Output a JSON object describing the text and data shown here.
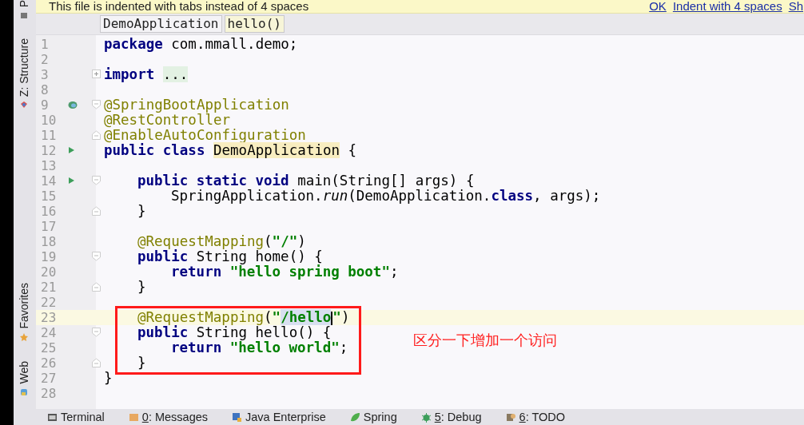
{
  "banner": {
    "message": "This file is indented with tabs instead of 4 spaces",
    "links": [
      "OK",
      "Indent with 4 spaces",
      "Sh"
    ]
  },
  "tool_stripe": [
    {
      "label": "P"
    },
    {
      "label": "Z: Structure"
    },
    {
      "label": "Favorites"
    },
    {
      "label": "Web"
    }
  ],
  "breadcrumbs": [
    {
      "label": "DemoApplication",
      "selected": false
    },
    {
      "label": "hello()",
      "selected": true
    }
  ],
  "lines": [
    {
      "number": "1",
      "kind": "top",
      "tokens": [
        {
          "kind": "keyword",
          "text": "package"
        },
        {
          "kind": "plain",
          "text": " com.mmall.demo;"
        }
      ]
    },
    {
      "number": "2",
      "kind": "blank"
    },
    {
      "number": "3",
      "kind": "top",
      "collapsed": true,
      "tokens": [
        {
          "kind": "keyword",
          "text": "import"
        },
        {
          "kind": "folded",
          "text": "..."
        }
      ]
    },
    {
      "number": "8",
      "kind": "blank"
    },
    {
      "number": "9",
      "kind": "top",
      "bean_marker": true,
      "fold_start": true,
      "tokens": [
        {
          "kind": "annotation",
          "text": "@SpringBootApplication"
        }
      ]
    },
    {
      "number": "10",
      "kind": "top",
      "tokens": [
        {
          "kind": "annotation",
          "text": "@RestController"
        }
      ]
    },
    {
      "number": "11",
      "kind": "top",
      "fold_end": true,
      "tokens": [
        {
          "kind": "annotation",
          "text": "@EnableAutoConfiguration"
        }
      ]
    },
    {
      "number": "12",
      "kind": "top",
      "run_marker": true,
      "tokens": [
        {
          "kind": "keyword",
          "text": "public class"
        },
        {
          "kind": "match",
          "text": "DemoApplication"
        },
        {
          "kind": "plain",
          "text": "{"
        }
      ]
    },
    {
      "number": "13",
      "kind": "blank"
    },
    {
      "number": "14",
      "kind": "member",
      "run_marker": true,
      "fold_start": true,
      "tokens": [
        {
          "kind": "keyword",
          "text": "public static void"
        },
        {
          "kind": "plain",
          "text": " main(String[] args) {"
        }
      ]
    },
    {
      "number": "15",
      "kind": "body",
      "tokens": [
        {
          "kind": "plain",
          "text": "SpringApplication."
        },
        {
          "kind": "italic",
          "text": "run"
        },
        {
          "kind": "plain",
          "text": "(DemoApplication."
        },
        {
          "kind": "keyword",
          "text": "class"
        },
        {
          "kind": "plain",
          "text": ", args);"
        }
      ]
    },
    {
      "number": "16",
      "kind": "member",
      "fold_end": true,
      "tokens": [
        {
          "kind": "plain",
          "text": "}"
        }
      ]
    },
    {
      "number": "17",
      "kind": "blank"
    },
    {
      "number": "18",
      "kind": "member",
      "tokens": [
        {
          "kind": "annotation",
          "text": "@RequestMapping"
        },
        {
          "kind": "plain",
          "text": "("
        },
        {
          "kind": "string",
          "text": "\"/\""
        },
        {
          "kind": "plain",
          "text": ")"
        }
      ]
    },
    {
      "number": "19",
      "kind": "member",
      "fold_start": true,
      "tokens": [
        {
          "kind": "keyword",
          "text": "public"
        },
        {
          "kind": "plain",
          "text": " String home() {"
        }
      ]
    },
    {
      "number": "20",
      "kind": "body",
      "tokens": [
        {
          "kind": "keyword",
          "text": "return"
        },
        {
          "kind": "string",
          "text": " \"hello spring boot\""
        },
        {
          "kind": "plain",
          "text": ";"
        }
      ]
    },
    {
      "number": "21",
      "kind": "member",
      "fold_end": true,
      "tokens": [
        {
          "kind": "plain",
          "text": "}"
        }
      ]
    },
    {
      "number": "22",
      "kind": "blank"
    },
    {
      "number": "23",
      "kind": "member",
      "current": true,
      "framed": true,
      "tokens": [
        {
          "kind": "annotation",
          "text": "@RequestMapping"
        },
        {
          "kind": "plain",
          "text": "("
        },
        {
          "kind": "string",
          "text": "\""
        },
        {
          "kind": "selected-string",
          "text": "/hello",
          "caret": true
        },
        {
          "kind": "string",
          "text": "\""
        },
        {
          "kind": "plain",
          "text": ")"
        }
      ]
    },
    {
      "number": "24",
      "kind": "member",
      "framed": true,
      "fold_start": true,
      "tokens": [
        {
          "kind": "keyword",
          "text": "public"
        },
        {
          "kind": "plain",
          "text": " String hello() {"
        }
      ]
    },
    {
      "number": "25",
      "kind": "body",
      "framed": true,
      "tokens": [
        {
          "kind": "keyword",
          "text": "return"
        },
        {
          "kind": "string",
          "text": " \"hello world\""
        },
        {
          "kind": "plain",
          "text": ";"
        }
      ]
    },
    {
      "number": "26",
      "kind": "member",
      "framed": true,
      "fold_end": true,
      "tokens": [
        {
          "kind": "plain",
          "text": "}"
        }
      ]
    },
    {
      "number": "27",
      "kind": "top",
      "tokens": [
        {
          "kind": "plain",
          "text": "}"
        }
      ]
    },
    {
      "number": "28",
      "kind": "blank"
    }
  ],
  "callout": {
    "note": "区分一下增加一个访问"
  },
  "bottom_tabs": [
    {
      "label": "Terminal"
    },
    {
      "mnemonic": "0",
      "label": ": Messages"
    },
    {
      "label": "Java Enterprise"
    },
    {
      "label": "Spring"
    },
    {
      "mnemonic": "5",
      "label": ": Debug"
    },
    {
      "mnemonic": "6",
      "label": ": TODO"
    }
  ]
}
